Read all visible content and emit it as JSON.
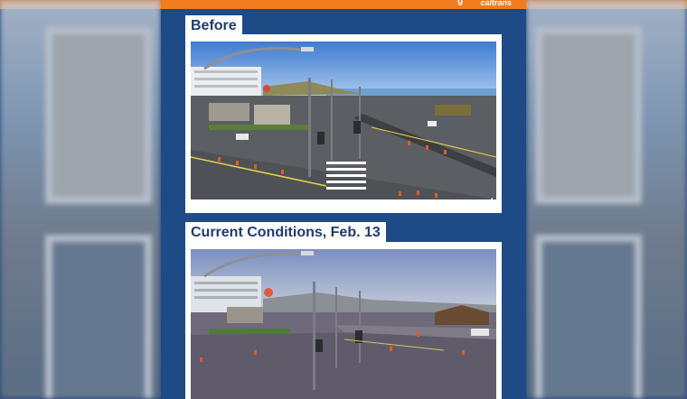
{
  "header": {
    "brand_text": "caltrans"
  },
  "panels": [
    {
      "label": "Before",
      "scene": "dry-intersection"
    },
    {
      "label": "Current Conditions, Feb. 13",
      "scene": "flooded-intersection"
    }
  ],
  "colors": {
    "accent": "#f07c1e",
    "poster_blue": "#1e4a86",
    "label_text": "#1e3c6e"
  }
}
